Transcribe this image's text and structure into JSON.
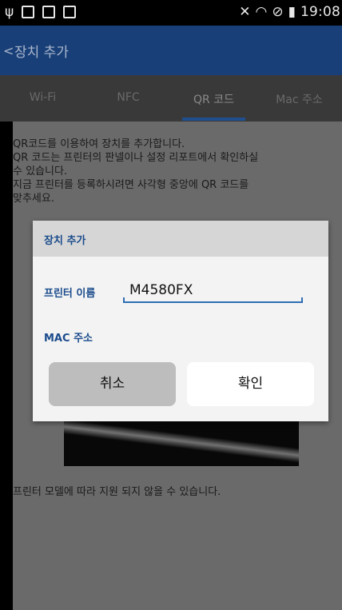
{
  "status_bar": {
    "time": "19:08"
  },
  "header": {
    "back_glyph": "<",
    "title": "장치 추가"
  },
  "tabs": [
    {
      "label": "Wi-Fi"
    },
    {
      "label": "NFC"
    },
    {
      "label": "QR 코드",
      "active": true
    },
    {
      "label": "Mac 주소"
    }
  ],
  "content": {
    "description": [
      "QR코드를 이용하여 장치를 추가합니다.",
      "QR 코드는 프린터의 판넬이나 설정 리포트에서 확인하실",
      "수 있습니다.",
      " 지금 프린터를 등록하시려면 사각형 중앙에 QR 코드를",
      "맞추세요."
    ],
    "note": "프린터 모델에 따라 지원 되지 않을 수 있습니다."
  },
  "dialog": {
    "title": "장치 추가",
    "printer_name_label": "프린터 이름",
    "printer_name_value": "M4580FX",
    "mac_label": "MAC 주소",
    "cancel_label": "취소",
    "ok_label": "확인"
  },
  "colors": {
    "appbar": "#193f78",
    "accent": "#1a4b8c",
    "underline": "#2e6eb5"
  }
}
